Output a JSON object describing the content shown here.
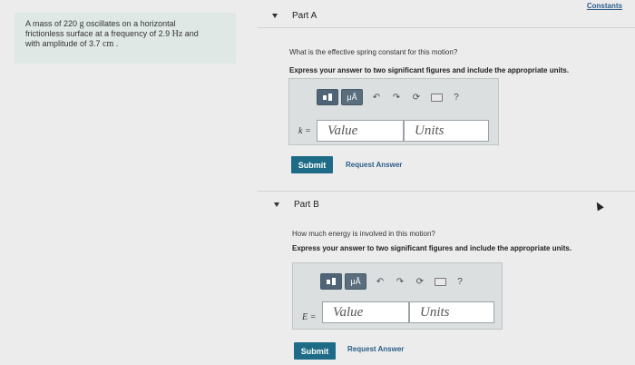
{
  "header": {
    "constants_link": "Constants"
  },
  "problem": {
    "text_line1": "A mass of 220 ",
    "unit_g": "g",
    "text_line1_end": " oscillates on a horizontal",
    "text_line2": "frictionless surface at a frequency of 2.9 ",
    "unit_hz": "Hz",
    "text_line2_end": " and",
    "text_line3": "with amplitude of 3.7 ",
    "unit_cm": "cm",
    "text_line3_end": " ."
  },
  "parts": [
    {
      "label": "Part A",
      "question": "What is the effective spring constant for this motion?",
      "instructions": "Express your answer to two significant figures and include the appropriate units.",
      "variable": "k =",
      "value_placeholder": "Value",
      "units_placeholder": "Units",
      "submit_label": "Submit",
      "request_label": "Request Answer"
    },
    {
      "label": "Part B",
      "question": "How much energy is involved in this motion?",
      "instructions": "Express your answer to two significant figures and include the appropriate units.",
      "variable": "E =",
      "value_placeholder": "Value",
      "units_placeholder": "Units",
      "submit_label": "Submit",
      "request_label": "Request Answer"
    }
  ],
  "toolbar": {
    "mu_label": "μÅ",
    "help_label": "?"
  },
  "icons": [
    "templates-icon",
    "units-icon",
    "undo-icon",
    "redo-icon",
    "reset-icon",
    "keyboard-icon",
    "help-icon"
  ]
}
